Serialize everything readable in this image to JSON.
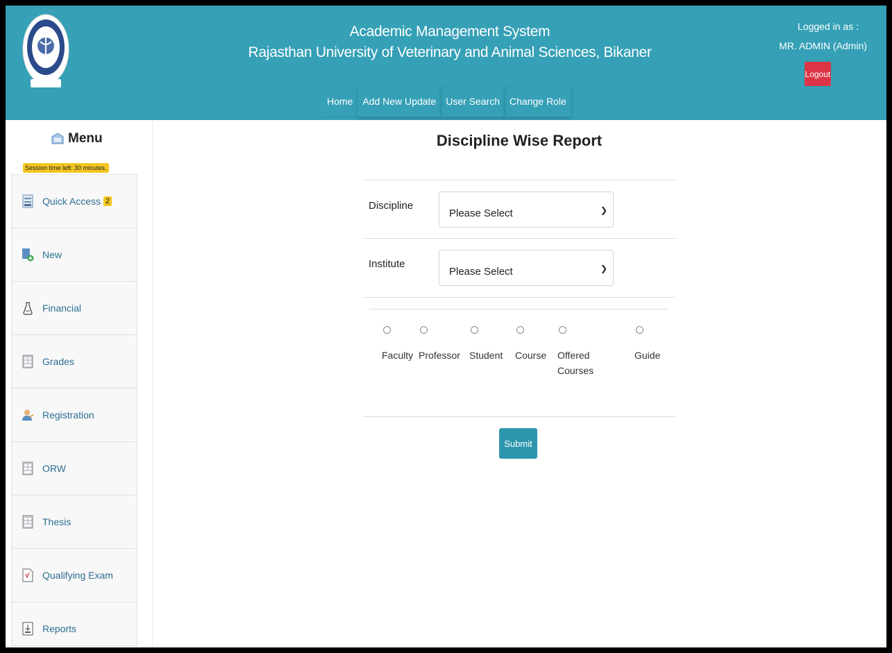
{
  "header": {
    "title": "Academic Management System",
    "subtitle": "Rajasthan University of Veterinary and Animal Sciences, Bikaner",
    "nav": [
      {
        "label": "Home"
      },
      {
        "label": "Add New Update"
      },
      {
        "label": "User Search"
      },
      {
        "label": "Change Role"
      }
    ],
    "logged_in_label": "Logged in as :",
    "user": "MR. ADMIN (Admin)",
    "logout_label": "Logout"
  },
  "sidebar": {
    "menu_title": "Menu",
    "session_text": "Session time left: 30 minutes.",
    "items": [
      {
        "label": "Quick Access",
        "icon": "quick-access-icon",
        "badge": "2"
      },
      {
        "label": "New",
        "icon": "new-document-icon"
      },
      {
        "label": "Financial",
        "icon": "financial-icon"
      },
      {
        "label": "Grades",
        "icon": "grades-icon"
      },
      {
        "label": "Registration",
        "icon": "registration-icon"
      },
      {
        "label": "ORW",
        "icon": "orw-icon"
      },
      {
        "label": "Thesis",
        "icon": "thesis-icon"
      },
      {
        "label": "Qualifying Exam",
        "icon": "qualifying-exam-icon"
      },
      {
        "label": "Reports",
        "icon": "reports-icon"
      }
    ]
  },
  "main": {
    "title": "Discipline Wise Report",
    "discipline_label": "Discipline",
    "discipline_value": "Please Select",
    "institute_label": "Institute",
    "institute_value": "Please Select",
    "options": [
      {
        "label": "Faculty"
      },
      {
        "label": "Professor"
      },
      {
        "label": "Student"
      },
      {
        "label": "Course"
      },
      {
        "label": "Offered Courses"
      },
      {
        "label": "Guide"
      }
    ],
    "submit_label": "Submit"
  },
  "colors": {
    "header_bg": "#35a0b6",
    "logout_bg": "#dc3545",
    "submit_bg": "#2d96ad",
    "badge_bg": "#f3c622"
  }
}
